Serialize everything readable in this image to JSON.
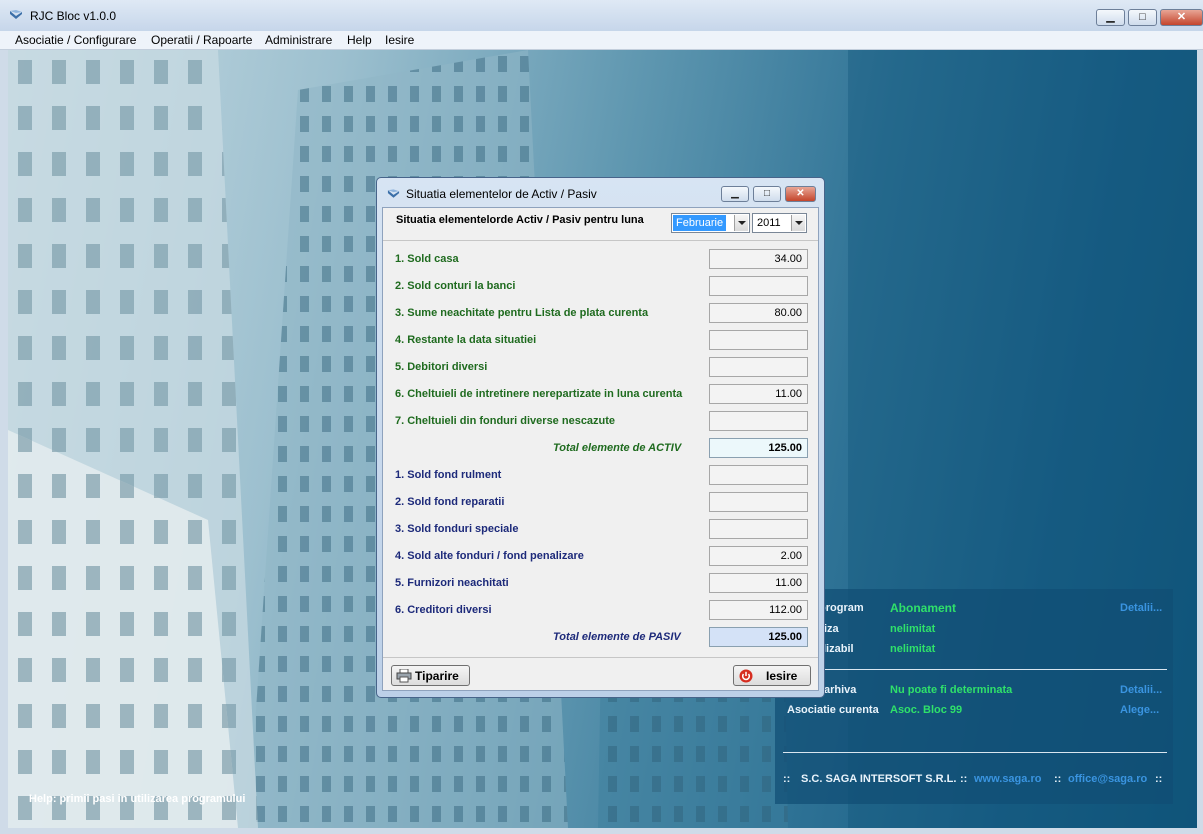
{
  "window": {
    "title": "RJC Bloc v1.0.0",
    "minimize": "▁",
    "maximize": "□",
    "close": "✕"
  },
  "menu": [
    "Asociatie / Configurare",
    "Operatii / Rapoarte",
    "Administrare",
    "Help",
    "Iesire"
  ],
  "help_text": "Help: primii pasi in utilizarea programului",
  "info_panel": {
    "row1": {
      "label": "program",
      "value": "Abonament",
      "link": "Detalii..."
    },
    "row2": {
      "label": "iza",
      "value": "nelimitat"
    },
    "row3": {
      "label": "lizabil",
      "value": "nelimitat"
    },
    "row4": {
      "label": "arhiva",
      "value": "Nu poate fi determinata",
      "link": "Detalii..."
    },
    "row5": {
      "label": "Asociatie curenta",
      "value": "Asoc. Bloc 99",
      "link": "Alege..."
    },
    "footer": {
      "sep1": "::",
      "company": "S.C. SAGA INTERSOFT S.R.L.",
      "sep2": "::",
      "website": "www.saga.ro",
      "sep3": "::",
      "email": "office@saga.ro",
      "sep4": "::"
    }
  },
  "dialog": {
    "title": "Situatia elementelor de Activ / Pasiv",
    "header_label": "Situatia elementelorde Activ / Pasiv pentru luna",
    "month": "Februarie",
    "year": "2011",
    "activ": [
      {
        "label": "1. Sold casa",
        "value": "34.00"
      },
      {
        "label": "2. Sold conturi la banci",
        "value": ""
      },
      {
        "label": "3. Sume neachitate pentru Lista de plata curenta",
        "value": "80.00"
      },
      {
        "label": "4. Restante la data situatiei",
        "value": ""
      },
      {
        "label": "5. Debitori diversi",
        "value": ""
      },
      {
        "label": "6. Cheltuieli de intretinere nerepartizate in luna curenta",
        "value": "11.00"
      },
      {
        "label": "7. Cheltuieli din fonduri diverse nescazute",
        "value": ""
      }
    ],
    "total_activ": {
      "label": "Total elemente de ACTIV",
      "value": "125.00"
    },
    "pasiv": [
      {
        "label": "1. Sold fond rulment",
        "value": ""
      },
      {
        "label": "2. Sold fond reparatii",
        "value": ""
      },
      {
        "label": "3. Sold fonduri speciale",
        "value": ""
      },
      {
        "label": "4. Sold alte fonduri / fond penalizare",
        "value": "2.00"
      },
      {
        "label": "5. Furnizori neachitati",
        "value": "11.00"
      },
      {
        "label": "6. Creditori diversi",
        "value": "112.00"
      }
    ],
    "total_pasiv": {
      "label": "Total elemente de PASIV",
      "value": "125.00"
    },
    "print_button": "Tiparire",
    "exit_button": "Iesire"
  }
}
